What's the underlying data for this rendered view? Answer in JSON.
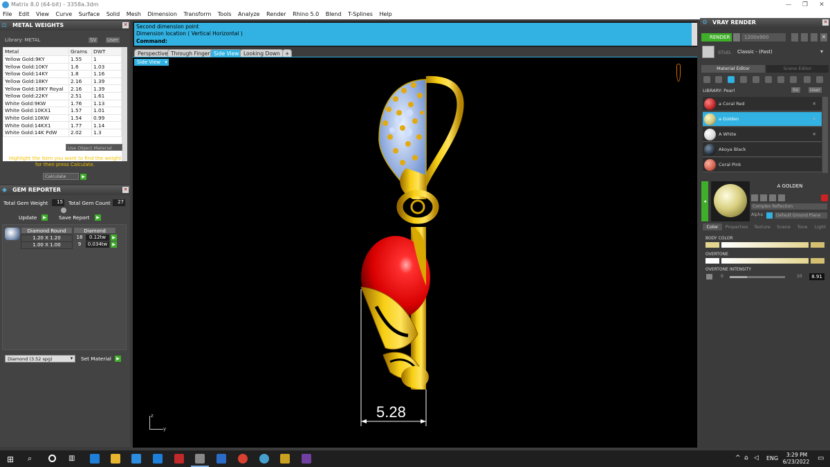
{
  "window": {
    "title": "Matrix 8.0 (64-bit) - 3358a.3dm",
    "min": "—",
    "max": "❐",
    "close": "✕"
  },
  "menu": [
    "File",
    "Edit",
    "View",
    "Curve",
    "Surface",
    "Solid",
    "Mesh",
    "Dimension",
    "Transform",
    "Tools",
    "Analyze",
    "Render",
    "Rhino 5.0",
    "Blend",
    "T-Splines",
    "Help"
  ],
  "metal_weights": {
    "title": "METAL WEIGHTS",
    "library_label": "Library: METAL",
    "sv": "SV",
    "user": "User",
    "headers": [
      "Metal",
      "Grams",
      "DWT"
    ],
    "rows": [
      [
        "Yellow Gold:9KY",
        "1.55",
        "1"
      ],
      [
        "Yellow Gold:10KY",
        "1.6",
        "1.03"
      ],
      [
        "Yellow Gold:14KY",
        "1.8",
        "1.16"
      ],
      [
        "Yellow Gold:18KY",
        "2.16",
        "1.39"
      ],
      [
        "Yellow Gold:18KY Royal",
        "2.16",
        "1.39"
      ],
      [
        "Yellow Gold:22KY",
        "2.51",
        "1.61"
      ],
      [
        "White Gold:9KW",
        "1.76",
        "1.13"
      ],
      [
        "White Gold:10KX1",
        "1.57",
        "1.01"
      ],
      [
        "White Gold:10KW",
        "1.54",
        "0.99"
      ],
      [
        "White Gold:14KX1",
        "1.77",
        "1.14"
      ],
      [
        "White Gold:14K PdW",
        "2.02",
        "1.3"
      ]
    ],
    "use_object_material": "Use Object Material",
    "hint": "Highlight the item you want to find the weight for then press Calculate.",
    "calculate": "Calculate"
  },
  "gem_reporter": {
    "title": "GEM REPORTER",
    "total_gem_weight_label": "Total Gem Weight",
    "total_gem_weight": "15",
    "total_gem_count_label": "Total Gem Count",
    "total_gem_count": "27",
    "update": "Update",
    "save_report": "Save Report",
    "col1": "Diamond Round",
    "col2": "Diamond",
    "rows": [
      [
        "1.20 X 1.20",
        "18",
        "0.12tw"
      ],
      [
        "1.00 X 1.00",
        "9",
        "0.034tw"
      ]
    ],
    "material_select": "Diamond   (3.52 spg)",
    "set_material": "Set Material"
  },
  "command": {
    "line1": "Second dimension point",
    "line2": "Dimension location ( Vertical  Horizontal )",
    "prompt": "Command:"
  },
  "tabs": [
    "Perspective",
    "Through Finger",
    "Side View",
    "Looking Down"
  ],
  "active_tab": "Side View",
  "viewport_label": "Side View",
  "dimension_value": "5.28",
  "axis": {
    "z": "z",
    "y": "y"
  },
  "vray": {
    "title": "VRAY RENDER",
    "render": "RENDER",
    "resolution": "1200x900",
    "studio_label": "STUD.",
    "studio_value": "Classic - (Fast)",
    "tabs": [
      "Material Editor",
      "Scene Editor"
    ],
    "library_label": "LIBRARY: Pearl",
    "sv": "SV",
    "user": "User",
    "materials": [
      {
        "name": "a Coral Red",
        "color": "#c0282a"
      },
      {
        "name": "a Golden",
        "color": "#c8c07a"
      },
      {
        "name": "A White",
        "color": "#e8e8e8"
      },
      {
        "name": "Akoya Black",
        "color": "#26303a"
      },
      {
        "name": "Coral Pink",
        "color": "#d06050"
      }
    ],
    "selected_material": "A GOLDEN",
    "reflection": "Complex Reflection",
    "alpha": "Alpha",
    "ground": "Default Ground Plane",
    "prop_tabs": [
      "Color",
      "Properties",
      "Texture",
      "Scene",
      "Tone",
      "Light"
    ],
    "body_color_label": "BODY COLOR",
    "overtone_label": "OVERTONE",
    "overtone_intensity_label": "OVERTONE INTENSITY",
    "intensity_min": "0",
    "intensity_max": "10",
    "intensity_value": "8.91"
  },
  "taskbar": {
    "lang": "ENG",
    "time": "3:29 PM",
    "date": "6/23/2022"
  },
  "colors": {
    "accent": "#32b2e2",
    "gold": "#f2c200",
    "ruby": "#e01010"
  }
}
